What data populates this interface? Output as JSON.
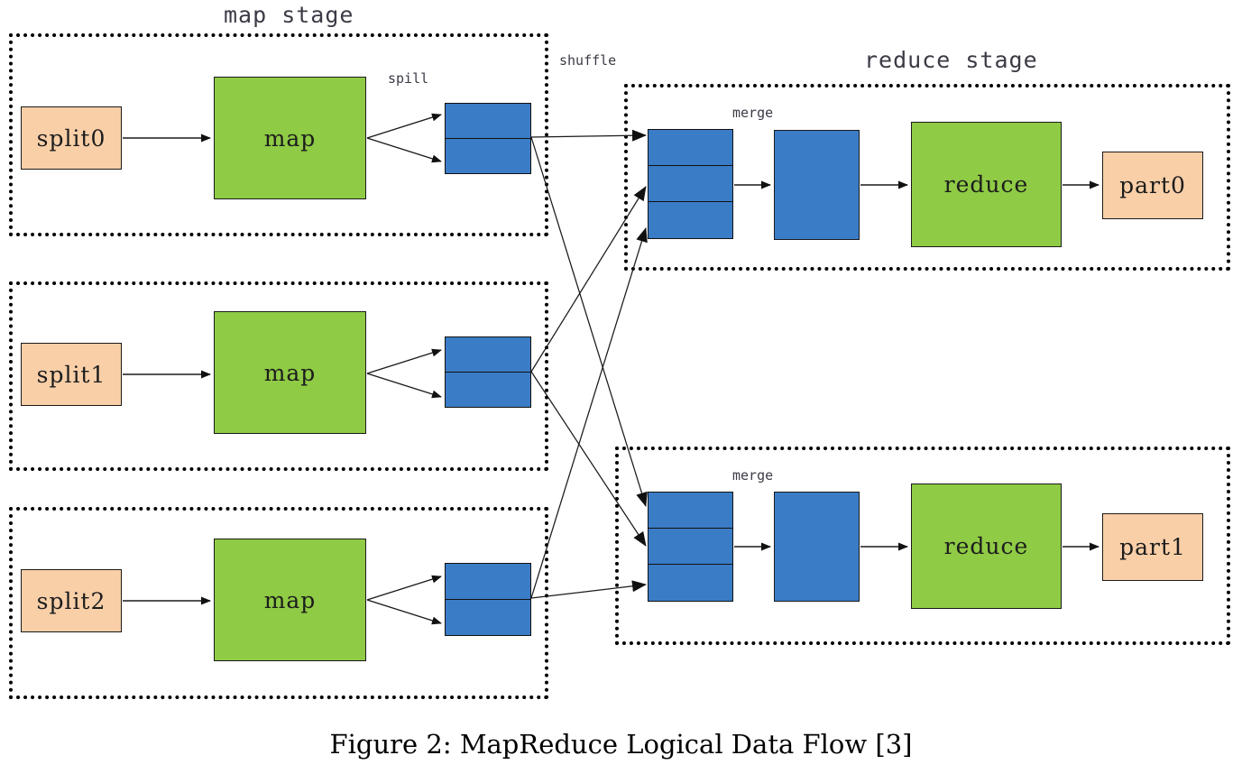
{
  "figure": {
    "caption": "Figure 2: MapReduce Logical Data Flow [3]",
    "colors": {
      "split_fill": "#f9cfa8",
      "part_fill": "#f9cfa8",
      "map_fill": "#8fcb45",
      "reduce_fill": "#8fcb45",
      "buffer_fill": "#3b7cc6",
      "stroke": "#1a1a1a",
      "container_border": "#000000",
      "label_text": "#3b3b46"
    }
  },
  "titles": {
    "map_stage": "map stage",
    "reduce_stage": "reduce stage",
    "shuffle": "shuffle",
    "spill": "spill",
    "merge": "merge"
  },
  "map_rows": [
    {
      "split": "split0",
      "map": "map"
    },
    {
      "split": "split1",
      "map": "map"
    },
    {
      "split": "split2",
      "map": "map"
    }
  ],
  "reduce_rows": [
    {
      "merge": "merge",
      "reduce": "reduce",
      "part": "part0"
    },
    {
      "merge": "merge",
      "reduce": "reduce",
      "part": "part1"
    }
  ]
}
